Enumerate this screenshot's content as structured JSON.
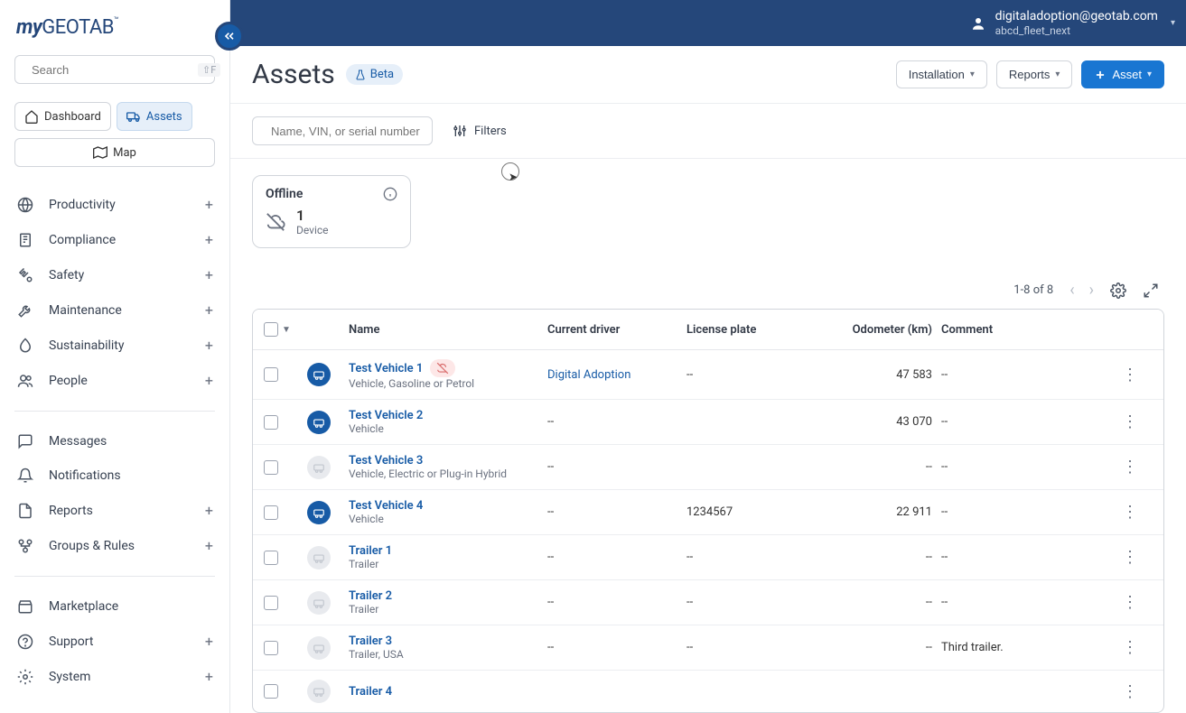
{
  "logo": {
    "prefix": "my",
    "main": "GEOTAB",
    "tm": "™"
  },
  "search": {
    "placeholder": "Search",
    "shortcut": "⇧F"
  },
  "navPills": {
    "dashboard": "Dashboard",
    "assets": "Assets",
    "map": "Map"
  },
  "sidebar": {
    "items": [
      {
        "label": "Productivity",
        "expandable": true
      },
      {
        "label": "Compliance",
        "expandable": true
      },
      {
        "label": "Safety",
        "expandable": true
      },
      {
        "label": "Maintenance",
        "expandable": true
      },
      {
        "label": "Sustainability",
        "expandable": true
      },
      {
        "label": "People",
        "expandable": true
      }
    ],
    "items2": [
      {
        "label": "Messages",
        "expandable": false
      },
      {
        "label": "Notifications",
        "expandable": false
      },
      {
        "label": "Reports",
        "expandable": true
      },
      {
        "label": "Groups & Rules",
        "expandable": true
      }
    ],
    "items3": [
      {
        "label": "Marketplace",
        "expandable": false
      },
      {
        "label": "Support",
        "expandable": true
      },
      {
        "label": "System",
        "expandable": true
      }
    ]
  },
  "topbar": {
    "email": "digitaladoption@geotab.com",
    "db": "abcd_fleet_next"
  },
  "page": {
    "title": "Assets",
    "betaLabel": "Beta",
    "actions": {
      "installation": "Installation",
      "reports": "Reports",
      "asset": "Asset"
    },
    "nameFilterPlaceholder": "Name, VIN, or serial number",
    "filtersLabel": "Filters"
  },
  "offlineCard": {
    "title": "Offline",
    "count": "1",
    "sub": "Device"
  },
  "tableMeta": {
    "range": "1-8 of 8"
  },
  "columns": {
    "name": "Name",
    "driver": "Current driver",
    "plate": "License plate",
    "odo": "Odometer (km)",
    "comment": "Comment"
  },
  "rows": [
    {
      "name": "Test Vehicle 1",
      "sub": "Vehicle, Gasoline or Petrol",
      "active": true,
      "alert": true,
      "driver": "Digital Adoption",
      "plate": "--",
      "odo": "47 583",
      "comment": "--"
    },
    {
      "name": "Test Vehicle 2",
      "sub": "Vehicle",
      "active": true,
      "alert": false,
      "driver": "--",
      "plate": "",
      "odo": "43 070",
      "comment": "--"
    },
    {
      "name": "Test Vehicle 3",
      "sub": "Vehicle, Electric or Plug-in Hybrid",
      "active": false,
      "alert": false,
      "driver": "--",
      "plate": "",
      "odo": "--",
      "comment": "--"
    },
    {
      "name": "Test Vehicle 4",
      "sub": "Vehicle",
      "active": true,
      "alert": false,
      "driver": "--",
      "plate": "1234567",
      "odo": "22 911",
      "comment": "--"
    },
    {
      "name": "Trailer 1",
      "sub": "Trailer",
      "active": false,
      "alert": false,
      "driver": "--",
      "plate": "--",
      "odo": "--",
      "comment": "--"
    },
    {
      "name": "Trailer 2",
      "sub": "Trailer",
      "active": false,
      "alert": false,
      "driver": "--",
      "plate": "--",
      "odo": "--",
      "comment": "--"
    },
    {
      "name": "Trailer 3",
      "sub": "Trailer, USA",
      "active": false,
      "alert": false,
      "driver": "--",
      "plate": "--",
      "odo": "--",
      "comment": "Third trailer."
    },
    {
      "name": "Trailer 4",
      "sub": "",
      "active": false,
      "alert": false,
      "driver": "",
      "plate": "",
      "odo": "",
      "comment": ""
    }
  ]
}
